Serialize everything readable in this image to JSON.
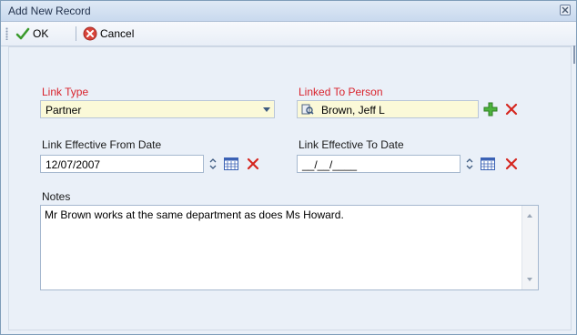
{
  "window": {
    "title": "Add New Record"
  },
  "toolbar": {
    "ok_label": "OK",
    "cancel_label": "Cancel"
  },
  "form": {
    "link_type": {
      "label": "Link Type",
      "value": "Partner"
    },
    "linked_to_person": {
      "label": "Linked To Person",
      "value": "Brown, Jeff L"
    },
    "effective_from": {
      "label": "Link Effective From Date",
      "value": "12/07/2007"
    },
    "effective_to": {
      "label": "Link Effective To Date",
      "value": "__/__/____"
    },
    "notes": {
      "label": "Notes",
      "value": "Mr Brown works at the same department as does Ms Howard."
    }
  },
  "icons": {
    "ok": "checkmark-icon",
    "cancel": "cancel-icon",
    "lookup": "magnifier-icon",
    "add": "plus-icon",
    "clear": "x-icon",
    "calendar": "calendar-icon"
  },
  "colors": {
    "required_label": "#d9232d",
    "field_yellow": "#fbf9d8",
    "accent": "#3d5a80"
  }
}
